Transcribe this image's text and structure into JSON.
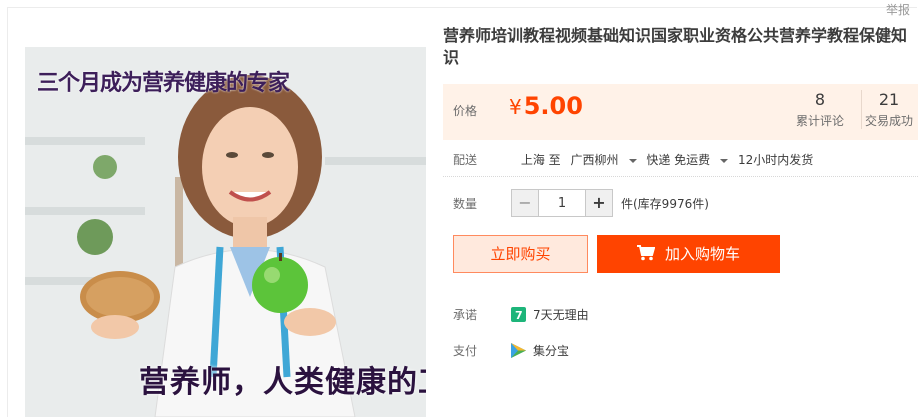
{
  "report_link": "举报",
  "image": {
    "top_caption": "三个月成为营养健康的专家",
    "bottom_caption": "营养师，人类健康的工程师"
  },
  "title": "营养师培训教程视频基础知识国家职业资格公共营养学教程保健知识",
  "price": {
    "label": "价格",
    "currency": "¥",
    "value": "5.00",
    "reviews_count": "8",
    "reviews_label": "累计评论",
    "deals_count": "21",
    "deals_label": "交易成功"
  },
  "shipping": {
    "label": "配送",
    "from": "上海 至",
    "to": "广西柳州",
    "method": "快递 免运费",
    "dispatch": "12小时内发货"
  },
  "quantity": {
    "label": "数量",
    "minus": "−",
    "value": "1",
    "plus": "+",
    "stock": "件(库存9976件)"
  },
  "actions": {
    "buy_now": "立即购买",
    "add_to_cart": "加入购物车"
  },
  "promise": {
    "label": "承诺",
    "text": "7天无理由"
  },
  "payment": {
    "label": "支付",
    "text": "集分宝"
  },
  "colors": {
    "accent": "#ff4400",
    "price_bg": "#fff2e8"
  }
}
